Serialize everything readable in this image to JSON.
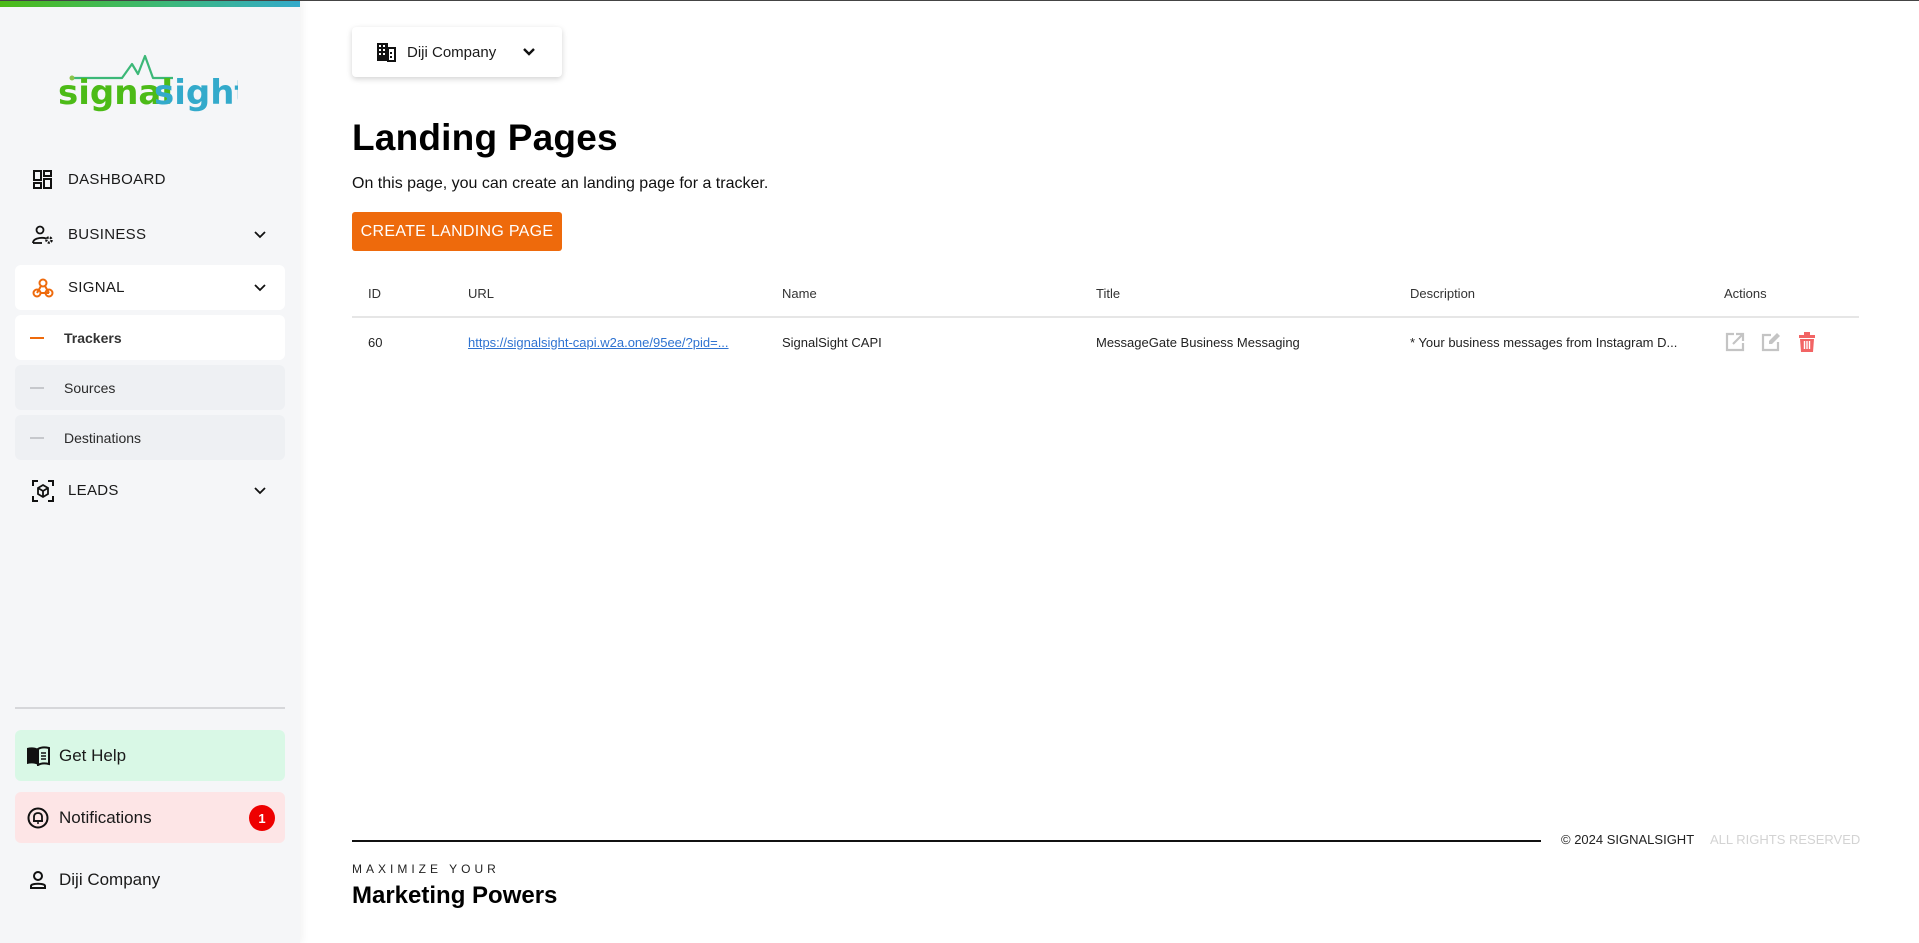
{
  "brand": {
    "logo_part1": "signal",
    "logo_part2": "sight",
    "colors": {
      "green": "#4cbb17",
      "teal": "#33aacb",
      "accent": "#ee6a0c"
    }
  },
  "sidebar": {
    "items": [
      {
        "label": "DASHBOARD",
        "icon": "dashboard-icon"
      },
      {
        "label": "BUSINESS",
        "icon": "user-gear-icon",
        "expandable": true
      },
      {
        "label": "SIGNAL",
        "icon": "webhook-icon",
        "expandable": true,
        "active": true
      },
      {
        "label": "LEADS",
        "icon": "cube-scan-icon",
        "expandable": true
      }
    ],
    "signal_subitems": [
      {
        "label": "Trackers",
        "active": true
      },
      {
        "label": "Sources"
      },
      {
        "label": "Destinations"
      }
    ],
    "help_label": "Get Help",
    "notifications_label": "Notifications",
    "notifications_count": "1",
    "user_label": "Diji Company"
  },
  "company_select": {
    "value": "Diji Company"
  },
  "page": {
    "title": "Landing Pages",
    "subtitle": "On this page, you can create an landing page for a tracker.",
    "create_button": "CREATE LANDING PAGE"
  },
  "table": {
    "headers": [
      "ID",
      "URL",
      "Name",
      "Title",
      "Description",
      "Actions"
    ],
    "rows": [
      {
        "id": "60",
        "url": "https://signalsight-capi.w2a.one/95ee/?pid=...",
        "name": "SignalSight CAPI",
        "title": "MessageGate Business Messaging",
        "description": "* Your business messages from Instagram D...",
        "actions": [
          "open-external",
          "edit",
          "delete"
        ]
      }
    ]
  },
  "footer": {
    "copyright": "© 2024 SIGNALSIGHT",
    "rights": "ALL RIGHTS RESERVED",
    "tagline_small": "MAXIMIZE YOUR",
    "tagline_big": "Marketing Powers"
  }
}
